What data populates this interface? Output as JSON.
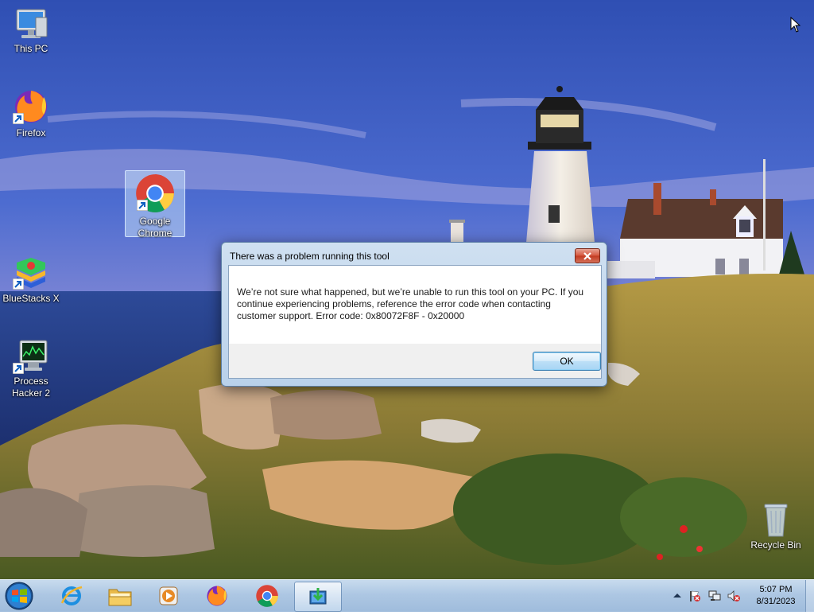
{
  "desktop": {
    "icons": [
      {
        "label": "This PC"
      },
      {
        "label": "Firefox"
      },
      {
        "label": "Google Chrome"
      },
      {
        "label": "BlueStacks X"
      },
      {
        "label": "Process Hacker 2"
      },
      {
        "label": "Recycle Bin"
      }
    ]
  },
  "dialog": {
    "title": "There was a problem running this tool",
    "message": "We’re not sure what happened, but we’re unable to run this tool on your PC. If you continue experiencing problems, reference the error code when contacting customer support. Error code: 0x80072F8F - 0x20000",
    "ok_label": "OK"
  },
  "taskbar": {
    "pinned": [
      "start-orb-icon",
      "internet-explorer-icon",
      "file-explorer-icon",
      "media-player-icon",
      "firefox-icon",
      "chrome-icon",
      "media-creation-tool-icon"
    ],
    "tray_icons": [
      "show-hidden-icons-icon",
      "action-center-flag-icon",
      "network-icon",
      "volume-muted-icon"
    ],
    "clock": {
      "time": "5:07 PM",
      "date": "8/31/2023"
    }
  },
  "colors": {
    "taskbar": "#adc7e3",
    "dialog_frame": "#b9d1ea",
    "close_button": "#c23a20",
    "ok_button_border": "#3c7fb1"
  }
}
